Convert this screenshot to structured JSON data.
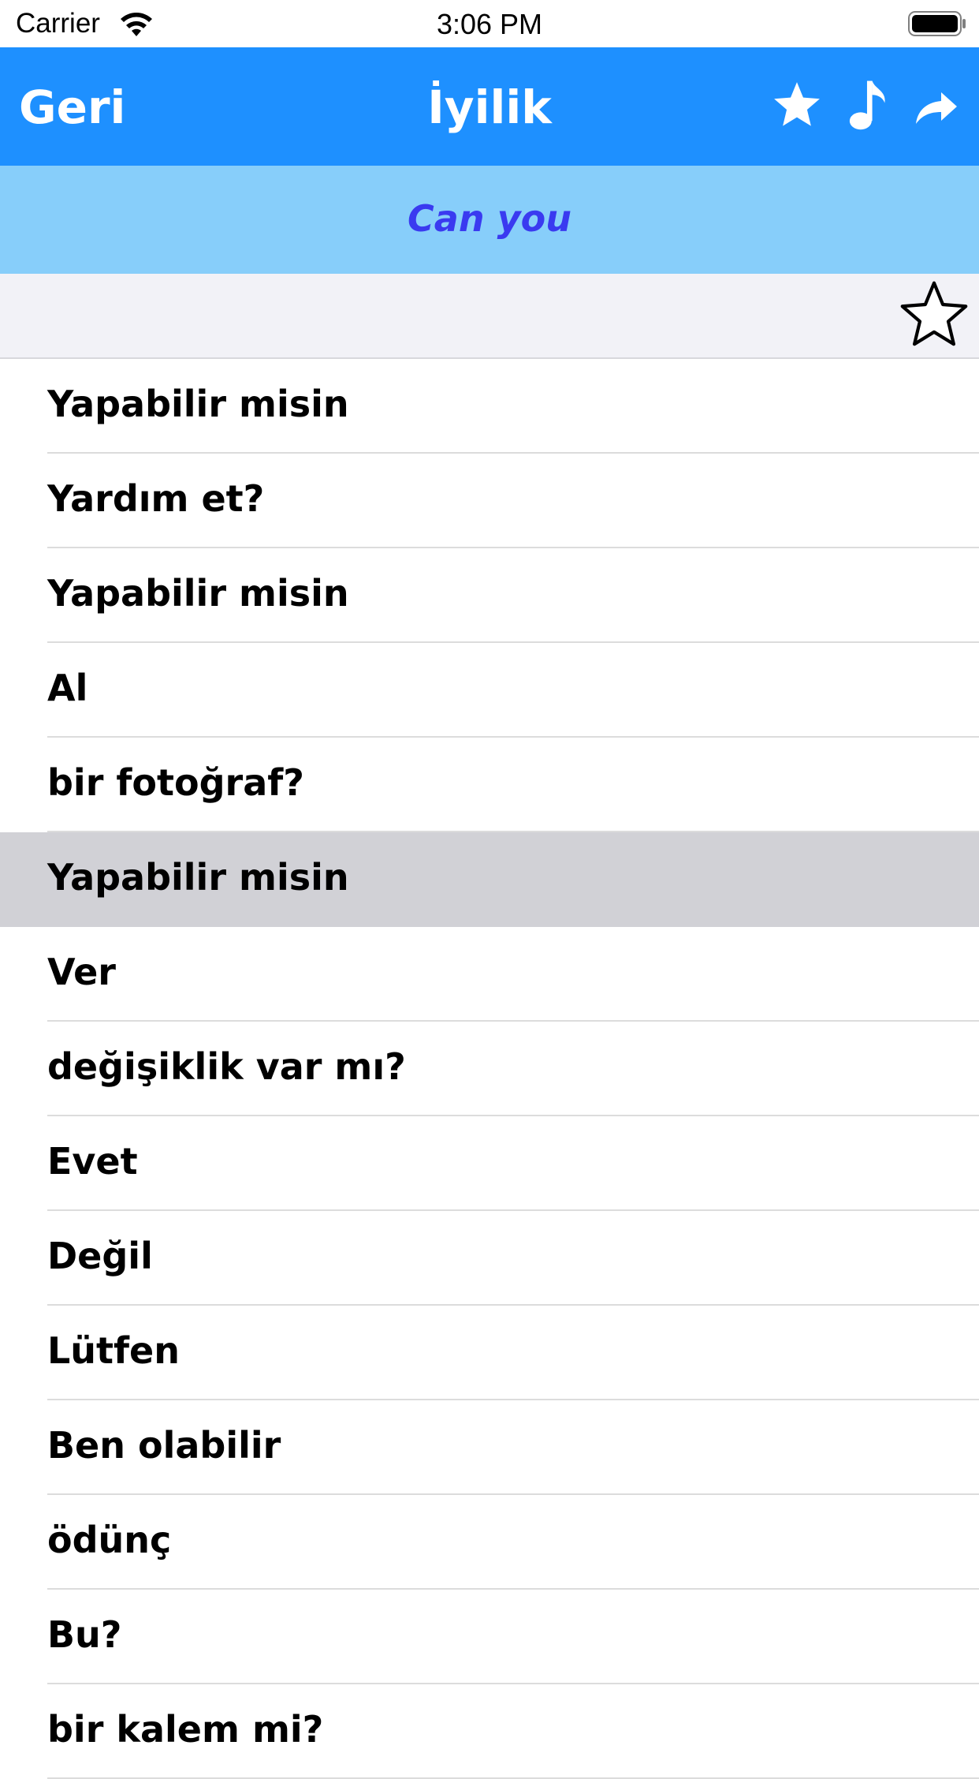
{
  "status_bar": {
    "carrier": "Carrier",
    "time": "3:06 PM"
  },
  "navbar": {
    "back_label": "Geri",
    "title": "İyilik",
    "icons": [
      "star-filled-icon",
      "music-note-icon",
      "share-arrow-icon"
    ]
  },
  "subtitle": "Can you",
  "colors": {
    "navbar": "#1e90ff",
    "subtitle_bar": "#87cefa",
    "subtitle_text": "#3a3af0",
    "selected_row": "#d1d1d6",
    "fav_row": "#f2f2f7"
  },
  "list": {
    "items": [
      {
        "label": "Yapabilir misin",
        "selected": false
      },
      {
        "label": "Yardım et?",
        "selected": false
      },
      {
        "label": "Yapabilir misin",
        "selected": false
      },
      {
        "label": "Al",
        "selected": false
      },
      {
        "label": "bir fotoğraf?",
        "selected": false
      },
      {
        "label": "Yapabilir misin",
        "selected": true
      },
      {
        "label": "Ver",
        "selected": false
      },
      {
        "label": "değişiklik var mı?",
        "selected": false
      },
      {
        "label": "Evet",
        "selected": false
      },
      {
        "label": "Değil",
        "selected": false
      },
      {
        "label": "Lütfen",
        "selected": false
      },
      {
        "label": "Ben olabilir",
        "selected": false
      },
      {
        "label": "ödünç",
        "selected": false
      },
      {
        "label": "Bu?",
        "selected": false
      },
      {
        "label": "bir kalem mi?",
        "selected": false
      }
    ]
  }
}
